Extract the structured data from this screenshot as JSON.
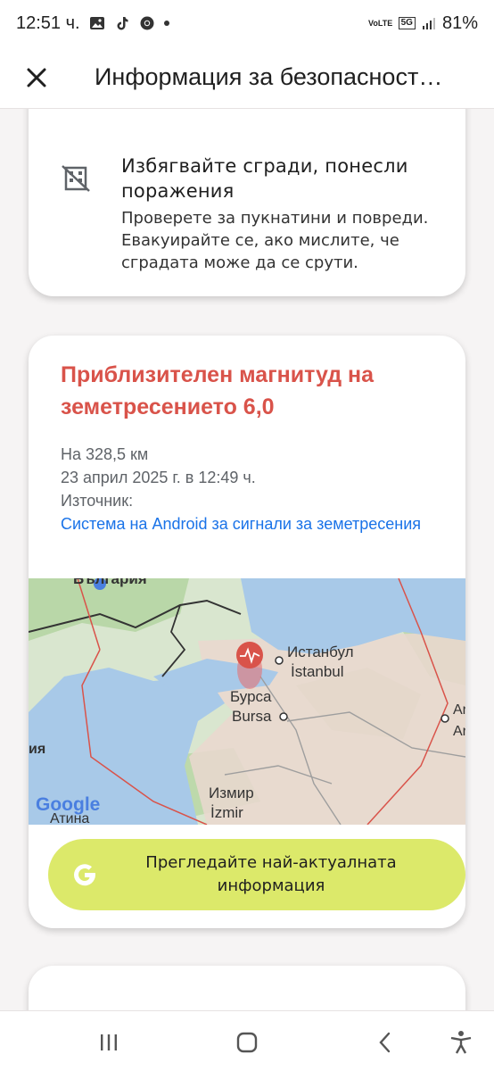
{
  "status_bar": {
    "time": "12:51 ч.",
    "network": "5G",
    "volte": "VoLTE",
    "battery": "81%"
  },
  "app_bar": {
    "title": "Информация за безопасност…"
  },
  "safety_tip": {
    "title": "Избягвайте сгради, понесли поражения",
    "description": "Проверете за пукнатини и повреди. Евакуирайте се, ако мислите, че сградата може да се срути."
  },
  "quake": {
    "title": "Приблизителен магнитуд на земетресението 6,0",
    "distance": "На 328,5 км",
    "datetime": "23 април 2025 г. в 12:49 ч.",
    "source_label": "Източник:",
    "source_link": "Система на Android за сигнали за земетресения",
    "accent_color": "#d9534a"
  },
  "map": {
    "labels": {
      "bulgaria": "България",
      "istanbul_bg": "Истанбул",
      "istanbul_tr": "İstanbul",
      "bursa_bg": "Бурса",
      "bursa_tr": "Bursa",
      "izmir_bg": "Измир",
      "izmir_tr": "İzmir",
      "athens": "Атина",
      "greece_partial": "ия",
      "ankara_partial_1": "Ar",
      "ankara_partial_2": "Ar",
      "google": "Google"
    }
  },
  "cta": {
    "label": "Прегледайте най-актуалната информация",
    "color": "#dce96a"
  },
  "nav": {
    "recents": "recents-icon",
    "home": "home-icon",
    "back": "back-icon",
    "accessibility": "accessibility-icon"
  }
}
